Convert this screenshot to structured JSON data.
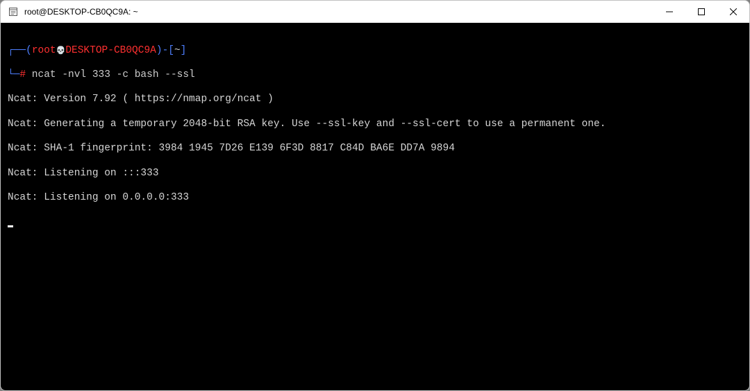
{
  "titlebar": {
    "title": "root@DESKTOP-CB0QC9A: ~"
  },
  "prompt": {
    "open_bracket": "┌──(",
    "user": "root",
    "at": "@",
    "diamond": "💀",
    "host": "DESKTOP-CB0QC9A",
    "close_paren": ")",
    "dash": "-[",
    "path": "~",
    "close_bracket": "]",
    "line2_prefix": "└─",
    "hash": "#",
    "command": " ncat -nvl 333 -c bash --ssl"
  },
  "output": {
    "line1": "Ncat: Version 7.92 ( https://nmap.org/ncat )",
    "line2": "Ncat: Generating a temporary 2048-bit RSA key. Use --ssl-key and --ssl-cert to use a permanent one.",
    "line3": "Ncat: SHA-1 fingerprint: 3984 1945 7D26 E139 6F3D 8817 C84D BA6E DD7A 9894",
    "line4": "Ncat: Listening on :::333",
    "line5": "Ncat: Listening on 0.0.0.0:333"
  }
}
